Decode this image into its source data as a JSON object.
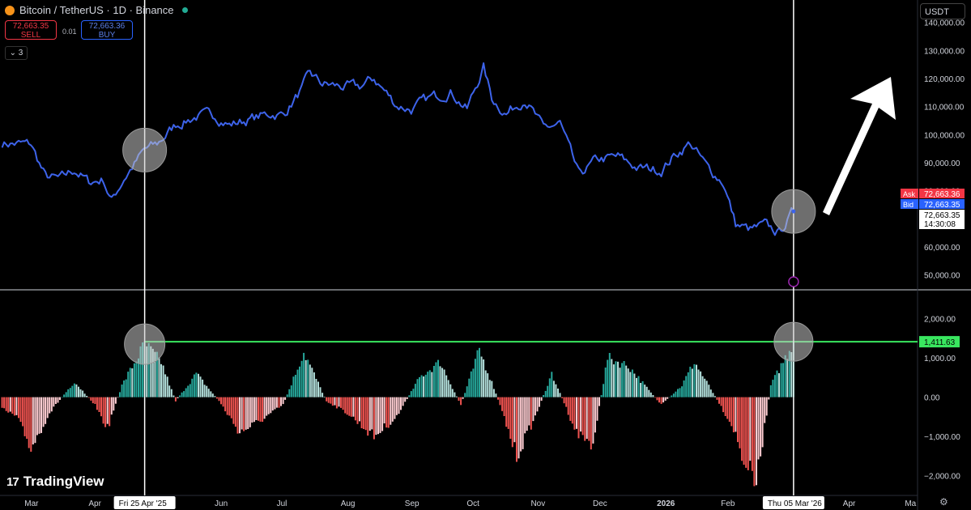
{
  "header": {
    "symbol": "Bitcoin / TetherUS · 1D · Binance",
    "sell_price": "72,663.35",
    "sell_label": "SELL",
    "buy_price": "72,663.36",
    "buy_label": "BUY",
    "spread": "0.01",
    "indicators_count": "3",
    "currency": "USDT",
    "brand": "TradingView"
  },
  "colors": {
    "price_line": "#3d63ea",
    "hist_pos": "#26a69a",
    "hist_pos_light": "#b2dfdb",
    "hist_neg": "#ef5350",
    "hist_neg_light": "#ffcdd2",
    "level_line": "#39e75f",
    "crosshair": "#ffffff"
  },
  "chart_data": [
    {
      "type": "line",
      "series": [
        {
          "x": [
            "2025-02-15",
            "2025-03-01",
            "2025-03-08",
            "2025-03-15",
            "2025-03-22",
            "2025-03-29",
            "2025-04-05",
            "2025-04-09",
            "2025-04-15",
            "2025-04-25",
            "2025-05-01",
            "2025-05-10",
            "2025-05-20",
            "2025-05-29",
            "2025-06-05",
            "2025-06-15",
            "2025-06-25",
            "2025-07-01",
            "2025-07-10",
            "2025-07-14",
            "2025-07-20",
            "2025-07-31",
            "2025-08-07",
            "2025-08-14",
            "2025-08-25",
            "2025-09-01",
            "2025-09-10",
            "2025-09-20",
            "2025-09-28",
            "2025-10-06",
            "2025-10-10",
            "2025-10-17",
            "2025-10-26",
            "2025-11-04",
            "2025-11-12",
            "2025-11-21",
            "2025-11-30",
            "2025-12-10",
            "2025-12-20",
            "2025-12-31",
            "2026-01-07",
            "2026-01-14",
            "2026-01-22",
            "2026-01-30",
            "2026-02-05",
            "2026-02-12",
            "2026-02-19",
            "2026-02-26",
            "2026-03-05"
          ],
          "y": [
            97000,
            96500,
            85000,
            84000,
            87500,
            83000,
            84000,
            76500,
            84500,
            94500,
            96500,
            103500,
            106500,
            107000,
            103500,
            105500,
            107500,
            107000,
            116000,
            121500,
            118000,
            117000,
            117000,
            120000,
            110500,
            109000,
            113000,
            115500,
            109000,
            124000,
            113000,
            107500,
            113000,
            102000,
            104000,
            85500,
            91000,
            92000,
            88000,
            87500,
            93000,
            97000,
            88500,
            83000,
            68000,
            66000,
            67500,
            65000,
            72663.35
          ]
        }
      ],
      "ylim": [
        45000,
        148000
      ],
      "y_ticks": [
        "140,000.00",
        "130,000.00",
        "120,000.00",
        "110,000.00",
        "100,000.00",
        "90,000.00",
        "80,000.00",
        "70,000.00",
        "60,000.00",
        "50,000.00"
      ],
      "price_labels": {
        "ask_label": "Ask",
        "ask_value": "72,663.36",
        "bid_label": "Bid",
        "bid_value": "72,663.35",
        "last_value": "72,663.35",
        "countdown": "14:30:08"
      }
    },
    {
      "type": "bar",
      "knots": {
        "x": [
          "2025-02-15",
          "2025-02-22",
          "2025-03-01",
          "2025-03-10",
          "2025-03-22",
          "2025-04-01",
          "2025-04-07",
          "2025-04-14",
          "2025-04-25",
          "2025-05-03",
          "2025-05-10",
          "2025-05-20",
          "2025-05-31",
          "2025-06-10",
          "2025-06-20",
          "2025-07-01",
          "2025-07-11",
          "2025-07-22",
          "2025-08-01",
          "2025-08-14",
          "2025-08-25",
          "2025-09-05",
          "2025-09-15",
          "2025-09-25",
          "2025-10-04",
          "2025-10-12",
          "2025-10-22",
          "2025-10-31",
          "2025-11-08",
          "2025-11-20",
          "2025-11-28",
          "2025-12-05",
          "2025-12-15",
          "2025-12-31",
          "2026-01-10",
          "2026-01-16",
          "2026-01-28",
          "2026-02-04",
          "2026-02-08",
          "2026-02-15",
          "2026-02-22",
          "2026-03-05"
        ],
        "y": [
          -300,
          -500,
          -1300,
          -400,
          400,
          -200,
          -800,
          300,
          1350,
          900,
          -100,
          600,
          -100,
          -900,
          -600,
          -200,
          1150,
          -100,
          -400,
          -1000,
          -500,
          500,
          900,
          -200,
          1200,
          100,
          -1500,
          -500,
          600,
          -900,
          -1200,
          1000,
          800,
          -200,
          300,
          900,
          -150,
          -800,
          -1500,
          -2200,
          300,
          1411.63
        ]
      },
      "ylim": [
        -2500,
        2650
      ],
      "y_ticks": [
        "2,000.00",
        "1,000.00",
        "0.00",
        "−1,000.00",
        "−2,000.00"
      ],
      "level_label": "1,411.63"
    }
  ],
  "x_axis": {
    "range": [
      "2025-02-14",
      "2026-05-04"
    ],
    "ticks": [
      {
        "date": "2025-03-01",
        "label": "Mar"
      },
      {
        "date": "2025-04-01",
        "label": "Apr"
      },
      {
        "date": "2025-06-01",
        "label": "Jun"
      },
      {
        "date": "2025-07-01",
        "label": "Jul"
      },
      {
        "date": "2025-08-01",
        "label": "Aug"
      },
      {
        "date": "2025-09-01",
        "label": "Sep"
      },
      {
        "date": "2025-10-01",
        "label": "Oct"
      },
      {
        "date": "2025-11-01",
        "label": "Nov"
      },
      {
        "date": "2025-12-01",
        "label": "Dec"
      },
      {
        "date": "2026-01-01",
        "label": "2026"
      },
      {
        "date": "2026-02-01",
        "label": "Feb"
      },
      {
        "date": "2026-04-01",
        "label": "Apr"
      },
      {
        "date": "2026-05-01",
        "label": "Ma"
      }
    ],
    "crosshairs": [
      {
        "date": "2025-04-25",
        "label": "Fri 25 Apr '25"
      },
      {
        "date": "2026-03-05",
        "label": "Thu 05 Mar '26"
      }
    ]
  }
}
